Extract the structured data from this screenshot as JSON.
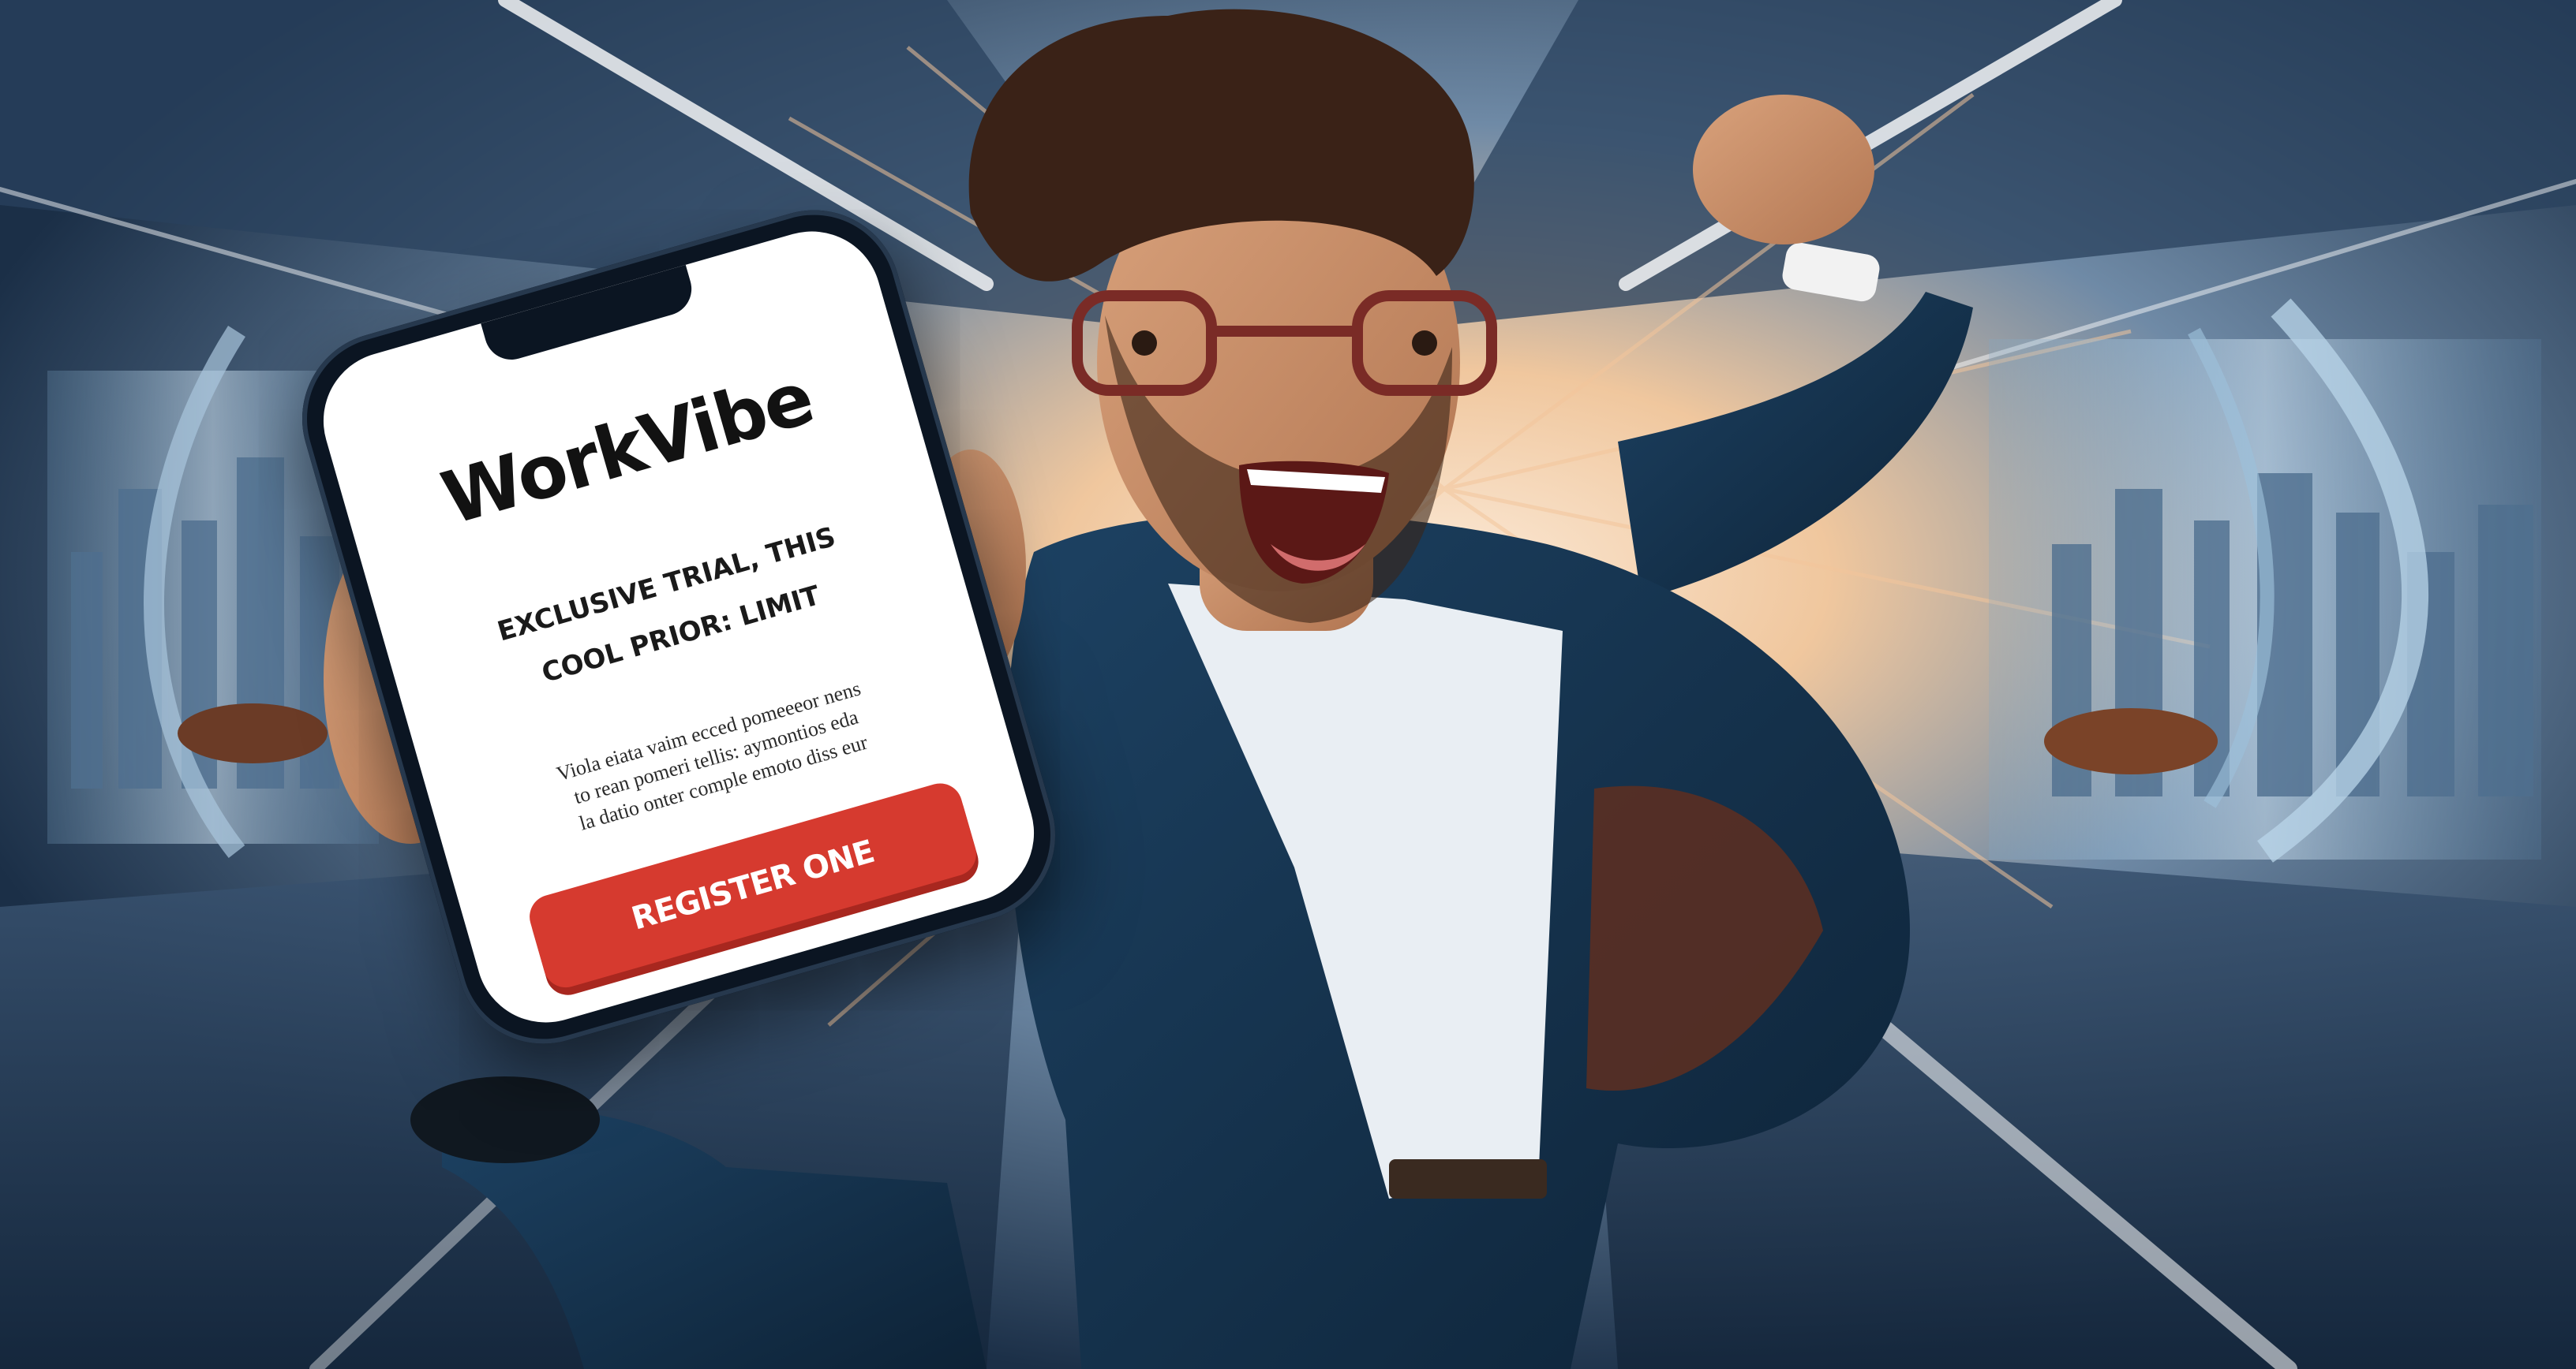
{
  "phone": {
    "app_name": "WorkVibe",
    "headline_lines": [
      "EXCLUSIVE TRIAL, THIS",
      "COOL PRIOR: LIMIT"
    ],
    "body_lines": [
      "Viola eiata vaim ecced pomeeeor nens",
      "to rean pomeri tellis: aymontios eda",
      "la datio onter comple emoto diss eur"
    ],
    "cta_label": "REGISTER ONE"
  },
  "colors": {
    "cta": "#d63a2f",
    "screen": "#ffffff",
    "jacket": "#143049",
    "background": "#1c3350"
  }
}
